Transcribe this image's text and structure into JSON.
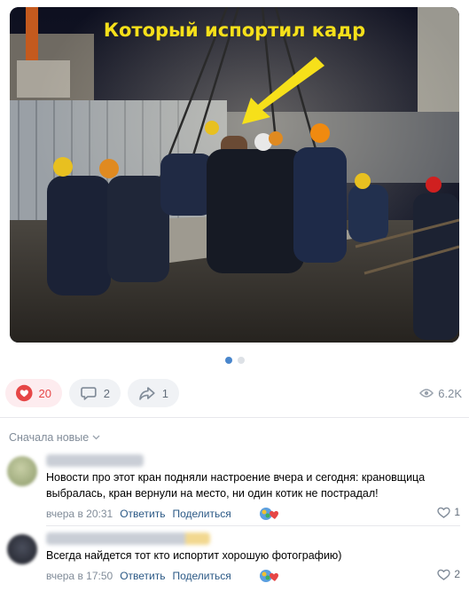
{
  "photo": {
    "caption": "Который испортил кадр"
  },
  "carousel": {
    "pages": 2,
    "current": 1
  },
  "actions": {
    "likes": "20",
    "comments": "2",
    "shares": "1",
    "views": "6.2K"
  },
  "comments_section": {
    "sort_label": "Сначала новые",
    "items": [
      {
        "text": "Новости про этот кран подняли настроение вчера и сегодня: крановщица выбралась, кран вернули на место, ни один котик не пострадал!",
        "time": "вчера в 20:31",
        "reply": "Ответить",
        "share": "Поделиться",
        "likes": "1"
      },
      {
        "text": "Всегда найдется тот кто испортит хорошую фотографию)",
        "time": "вчера в 17:50",
        "reply": "Ответить",
        "share": "Поделиться",
        "likes": "2"
      }
    ]
  },
  "colors": {
    "accent": "#4986cc",
    "link": "#2a5885",
    "like": "#e64646",
    "caption": "#f6e01a"
  }
}
